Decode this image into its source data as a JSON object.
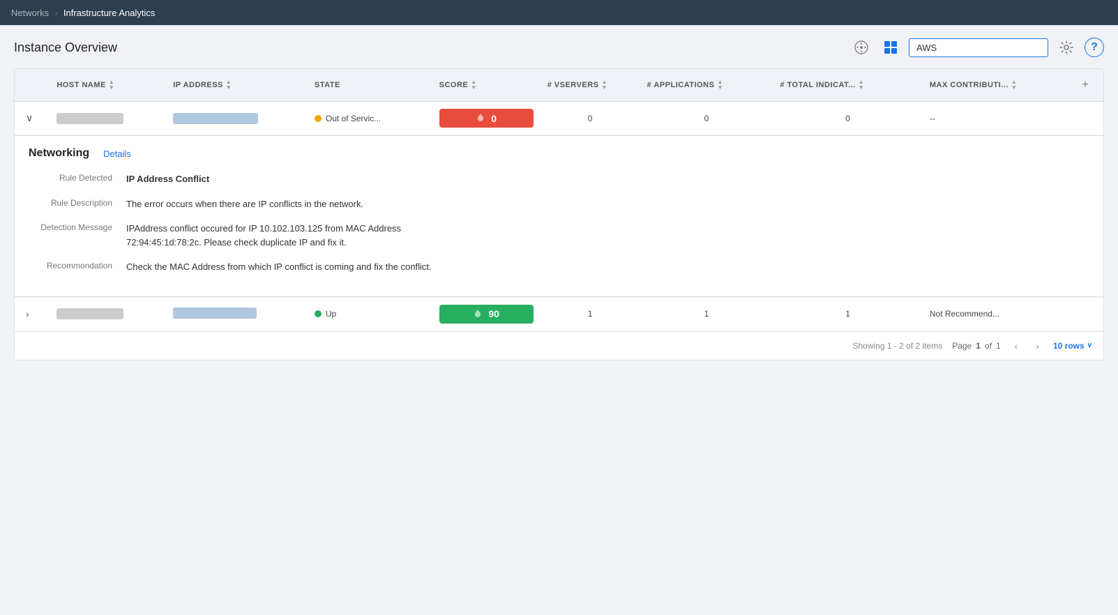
{
  "nav": {
    "parent": "Networks",
    "separator": "›",
    "current": "Infrastructure Analytics"
  },
  "header": {
    "title": "Instance Overview",
    "search_value": "AWS"
  },
  "icons": {
    "settings": "⚙",
    "help": "?",
    "grid": "▦",
    "dots_circle": "⊙",
    "add_col": "+",
    "sort_up": "▲",
    "sort_down": "▼",
    "expand_open": "∨",
    "expand_closed": "›",
    "score_icon": "↑",
    "chevron_left": "‹",
    "chevron_right": "›",
    "rows_chevron": "∨"
  },
  "table": {
    "columns": [
      {
        "key": "expand",
        "label": ""
      },
      {
        "key": "hostname",
        "label": "HOST NAME",
        "sortable": true
      },
      {
        "key": "ip",
        "label": "IP ADDRESS",
        "sortable": true
      },
      {
        "key": "state",
        "label": "STATE",
        "sortable": false
      },
      {
        "key": "score",
        "label": "SCORE",
        "sortable": true
      },
      {
        "key": "vservers",
        "label": "# VSERVERS",
        "sortable": true
      },
      {
        "key": "applications",
        "label": "# APPLICATIONS",
        "sortable": true
      },
      {
        "key": "total_indicators",
        "label": "# TOTAL INDICAT...",
        "sortable": true
      },
      {
        "key": "max_contribution",
        "label": "MAX CONTRIBUTI...",
        "sortable": true
      },
      {
        "key": "add",
        "label": ""
      }
    ],
    "rows": [
      {
        "id": "row1",
        "expanded": true,
        "hostname_masked": true,
        "ip_masked": true,
        "state": "Out of Servic...",
        "state_color": "orange",
        "score": 0,
        "score_color": "red",
        "vservers": 0,
        "applications": 0,
        "total_indicators": 0,
        "max_contribution": "--"
      },
      {
        "id": "row2",
        "expanded": false,
        "hostname_masked": true,
        "ip_masked": true,
        "state": "Up",
        "state_color": "green",
        "score": 90,
        "score_color": "green",
        "vservers": 1,
        "applications": 1,
        "total_indicators": 1,
        "max_contribution": "Not Recommend..."
      }
    ],
    "expanded_detail": {
      "section_title": "Networking",
      "details_link": "Details",
      "rule_detected_label": "Rule Detected",
      "rule_detected_value": "IP Address Conflict",
      "rule_description_label": "Rule Description",
      "rule_description_value": "The error occurs when there are IP conflicts in the network.",
      "detection_message_label": "Detection Message",
      "detection_message_value": "IPAddress conflict occured for IP 10.102.103.125 from MAC Address 72:94:45:1d:78:2c. Please check duplicate IP and fix it.",
      "recommendation_label": "Recommondation",
      "recommendation_value": "Check the MAC Address from which IP conflict is coming and fix the conflict."
    }
  },
  "footer": {
    "showing_text": "Showing 1 - 2 of 2 items",
    "page_label": "Page",
    "page_current": "1",
    "page_of": "of",
    "page_total": "1",
    "rows_label": "10 rows"
  }
}
